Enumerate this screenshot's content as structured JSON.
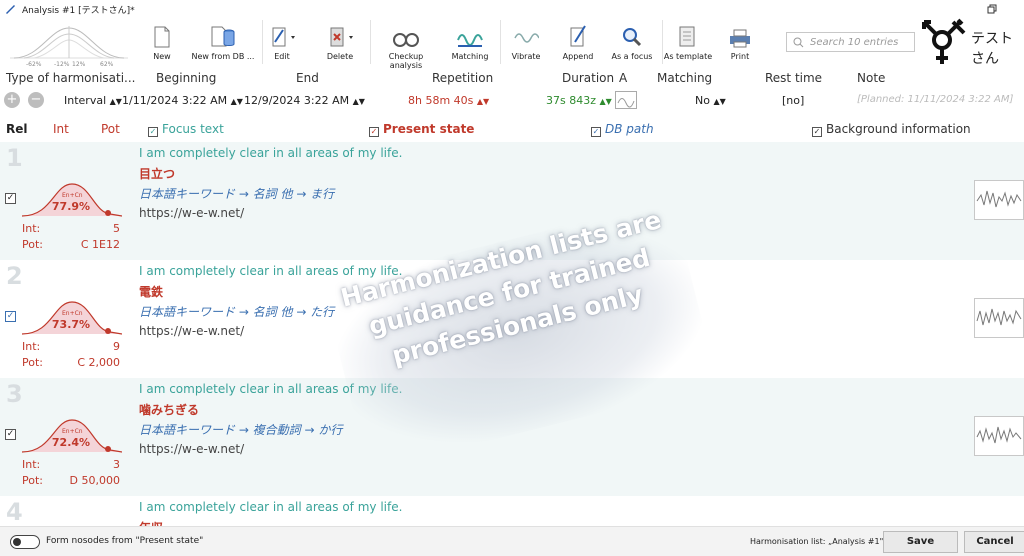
{
  "window": {
    "title": "Analysis #1 [テストさん]*"
  },
  "toolbar": {
    "new": "New",
    "new_from_db": "New from DB ...",
    "edit": "Edit",
    "delete": "Delete",
    "checkup": "Checkup analysis",
    "matching": "Matching",
    "vibrate": "Vibrate",
    "append": "Append",
    "as_focus": "As a focus",
    "as_template": "As template",
    "print": "Print",
    "search_placeholder": "Search 10 entries",
    "user_name": "テストさん",
    "dist_ticks": [
      "-62%",
      "-12%",
      "12%",
      "62%"
    ]
  },
  "header": {
    "type": "Type of harmonisati...",
    "beginning": "Beginning",
    "end": "End",
    "repetition": "Repetition",
    "duration": "Duration",
    "a": "A",
    "matching": "Matching",
    "rest_time": "Rest time",
    "note": "Note"
  },
  "values": {
    "type": "Interval",
    "beginning": "1/11/2024 3:22 AM",
    "end": "12/9/2024 3:22 AM",
    "repetition": "8h 58m 40s",
    "duration": "37s 843z",
    "matching": "No",
    "rest_time": "[no]",
    "note": "[Planned: 11/11/2024 3:22 AM]"
  },
  "columns": {
    "rel": "Rel",
    "int": "Int",
    "pot": "Pot",
    "focus_text": "Focus text",
    "present_state": "Present state",
    "db_path": "DB path",
    "background_info": "Background information"
  },
  "entries": [
    {
      "num": "1",
      "pct": "77.9%",
      "curve_label": "En+Cn",
      "int_label": "Int:",
      "int": "5",
      "pot_label": "Pot:",
      "pot": "C 1E12",
      "focus": "I am completely clear in all areas of my life.",
      "state": "目立つ",
      "keyword": "日本語キーワード → 名詞 他 → ま行",
      "url": "https://w-e-w.net/",
      "checked": true
    },
    {
      "num": "2",
      "pct": "73.7%",
      "curve_label": "En+Cn",
      "int_label": "Int:",
      "int": "9",
      "pot_label": "Pot:",
      "pot": "C 2,000",
      "focus": "I am completely clear in all areas of my life.",
      "state": "電鉄",
      "keyword": "日本語キーワード → 名詞 他 → た行",
      "url": "https://w-e-w.net/",
      "checked": true
    },
    {
      "num": "3",
      "pct": "72.4%",
      "curve_label": "En+Cn",
      "int_label": "Int:",
      "int": "3",
      "pot_label": "Pot:",
      "pot": "D 50,000",
      "focus": "I am completely clear in all areas of my life.",
      "state": "噛みちぎる",
      "keyword": "日本語キーワード → 複合動詞 → か行",
      "url": "https://w-e-w.net/",
      "checked": true
    },
    {
      "num": "4",
      "focus": "I am completely clear in all areas of my life.",
      "state": "年収"
    }
  ],
  "watermark": [
    "Harmonization lists are",
    "guidance for trained",
    "professionals only"
  ],
  "footer": {
    "toggle_label": "Form nosodes from \"Present state\"",
    "list_label": "Harmonisation list: „Analysis #1\"",
    "save": "Save",
    "cancel": "Cancel"
  },
  "colors": {
    "accent_red": "#c0392b",
    "focus_teal": "#3aa39a",
    "keyword_blue": "#3a6fb0",
    "row_bg": "#f1f7f7",
    "duration_green": "#2e8b2e"
  }
}
